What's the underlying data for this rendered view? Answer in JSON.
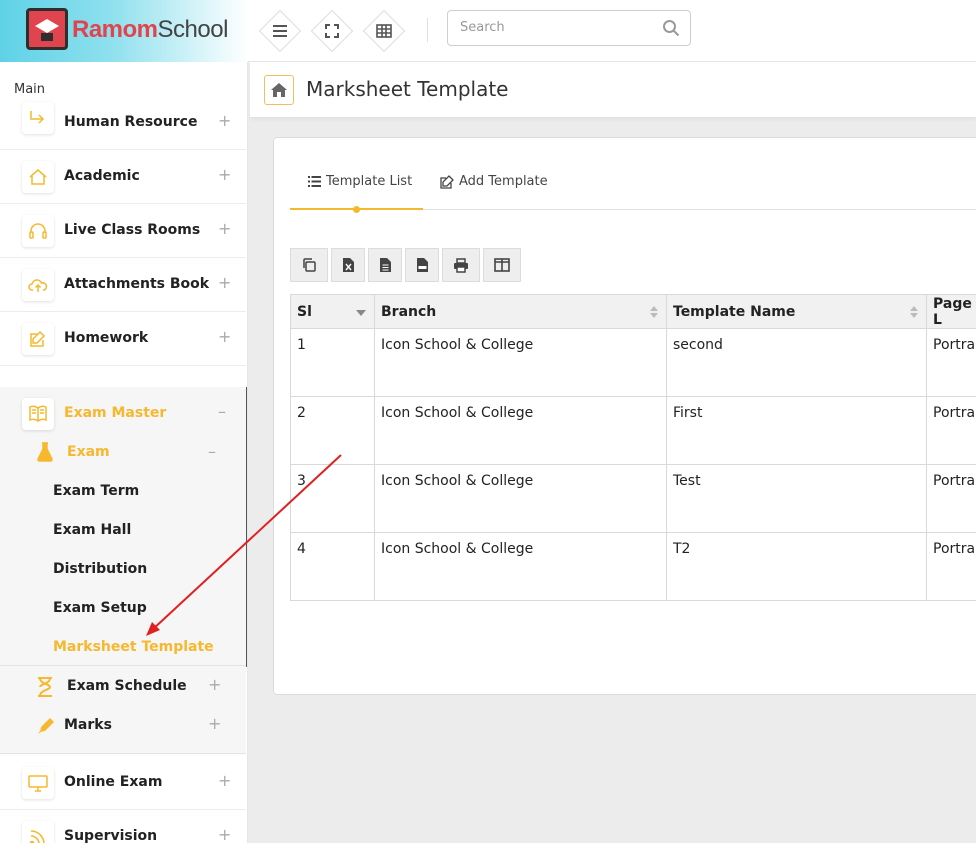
{
  "app": {
    "logo_part1": "Ramom",
    "logo_part2": "School"
  },
  "header": {
    "search_placeholder": "Search"
  },
  "page": {
    "title": "Marksheet Template"
  },
  "sidebar": {
    "section_label": "Main",
    "items": [
      {
        "label": "Human Resource",
        "icon": "return-icon",
        "toggle": "+"
      },
      {
        "label": "Academic",
        "icon": "home-icon",
        "toggle": "+"
      },
      {
        "label": "Live Class Rooms",
        "icon": "headset-icon",
        "toggle": "+"
      },
      {
        "label": "Attachments Book",
        "icon": "cloud-upload-icon",
        "toggle": "+"
      },
      {
        "label": "Homework",
        "icon": "edit-icon",
        "toggle": "+"
      },
      {
        "label": "Exam Master",
        "icon": "book-icon",
        "toggle": "–"
      }
    ],
    "exam": {
      "label": "Exam",
      "toggle": "–",
      "links": [
        "Exam Term",
        "Exam Hall",
        "Distribution",
        "Exam Setup",
        "Marksheet Template"
      ]
    },
    "exam_schedule": {
      "label": "Exam Schedule",
      "toggle": "+"
    },
    "marks": {
      "label": "Marks",
      "toggle": "+"
    },
    "bottom_items": [
      {
        "label": "Online Exam",
        "icon": "monitor-icon",
        "toggle": "+"
      },
      {
        "label": "Supervision",
        "icon": "rss-icon",
        "toggle": "+"
      }
    ]
  },
  "tabs": {
    "list": "Template List",
    "add": "Add Template"
  },
  "table": {
    "headers": [
      "Sl",
      "Branch",
      "Template Name",
      "Page L"
    ],
    "rows": [
      [
        "1",
        "Icon School & College",
        "second",
        "Portrai"
      ],
      [
        "2",
        "Icon School & College",
        "First",
        "Portrai"
      ],
      [
        "3",
        "Icon School & College",
        "Test",
        "Portrai"
      ],
      [
        "4",
        "Icon School & College",
        "T2",
        "Portrai"
      ]
    ]
  },
  "colors": {
    "accent": "#f5b82e",
    "brand": "#e0454f",
    "annotation_arrow": "#e02020"
  }
}
